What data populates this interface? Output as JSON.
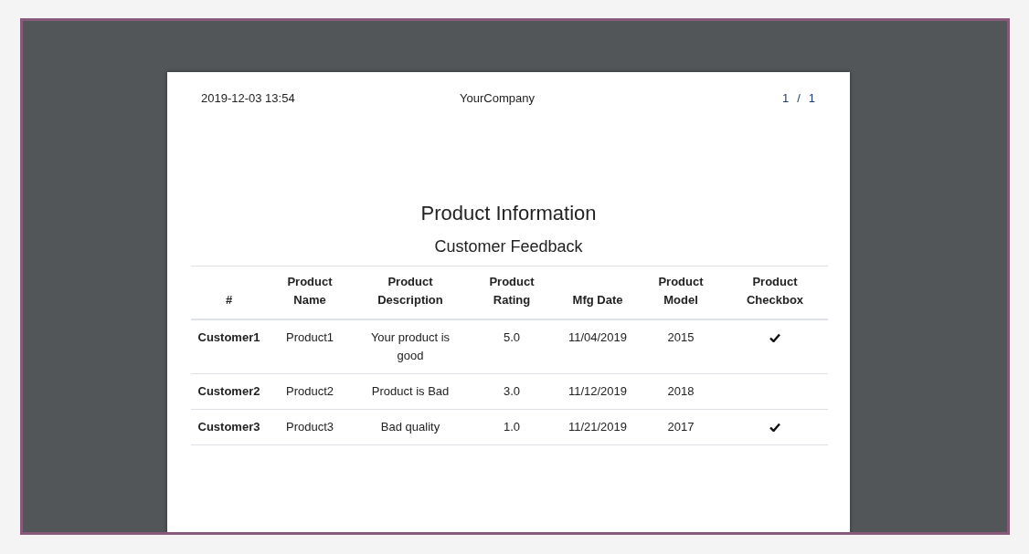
{
  "header": {
    "timestamp": "2019-12-03 13:54",
    "company": "YourCompany",
    "page_number": "1",
    "separator": "/",
    "page_count": "1"
  },
  "title": "Product Information",
  "subtitle": "Customer Feedback",
  "table": {
    "columns": [
      "#",
      "Product Name",
      "Product Description",
      "Product Rating",
      "Mfg Date",
      "Product Model",
      "Product Checkbox"
    ],
    "rows": [
      {
        "customer": "Customer1",
        "name": "Product1",
        "description": "Your product is good",
        "rating": "5.0",
        "mfg_date": "11/04/2019",
        "model": "2015",
        "checked": true
      },
      {
        "customer": "Customer2",
        "name": "Product2",
        "description": "Product is Bad",
        "rating": "3.0",
        "mfg_date": "11/12/2019",
        "model": "2018",
        "checked": false
      },
      {
        "customer": "Customer3",
        "name": "Product3",
        "description": "Bad quality",
        "rating": "1.0",
        "mfg_date": "11/21/2019",
        "model": "2017",
        "checked": true
      }
    ]
  }
}
